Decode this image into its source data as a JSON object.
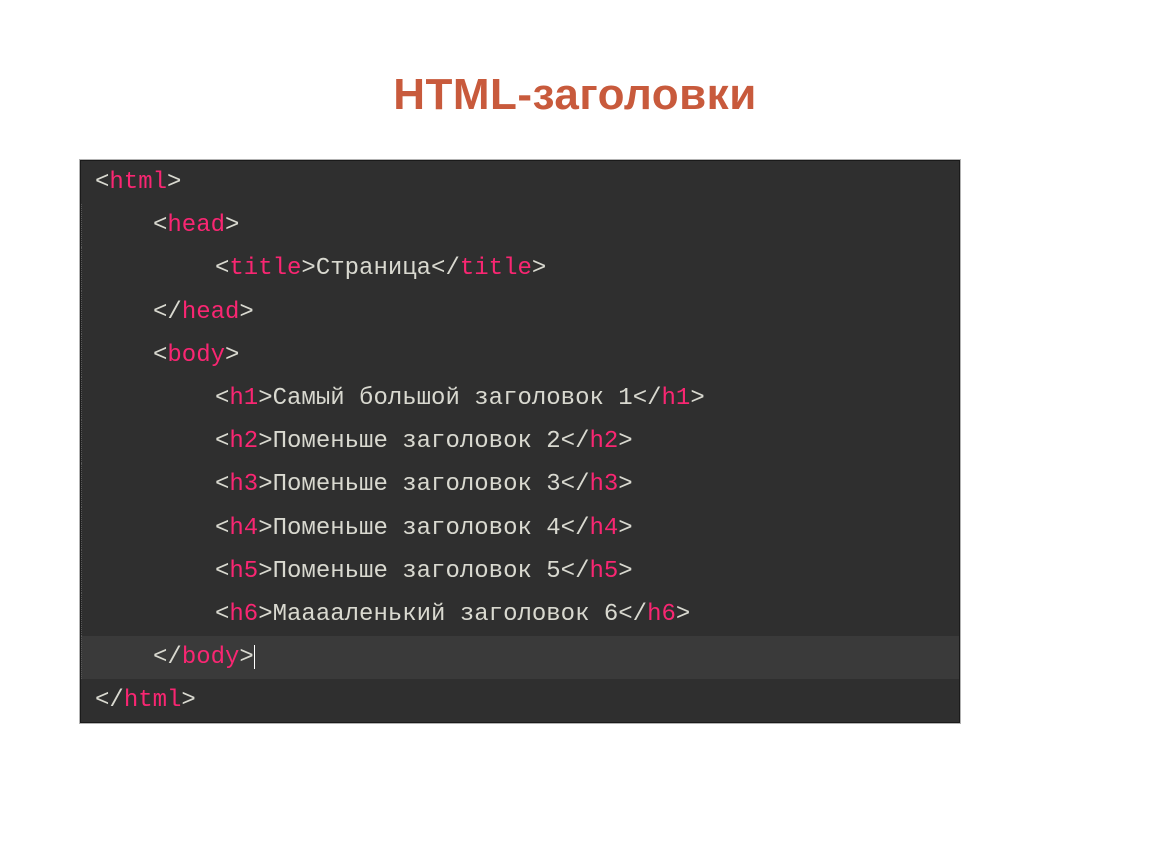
{
  "slide_title": "HTML-заголовки",
  "code": {
    "lines": [
      {
        "indent": 0,
        "highlight": false,
        "segments": [
          {
            "t": "br",
            "v": "<"
          },
          {
            "t": "tag",
            "v": "html"
          },
          {
            "t": "br",
            "v": ">"
          }
        ]
      },
      {
        "indent": 1,
        "highlight": false,
        "segments": [
          {
            "t": "br",
            "v": "<"
          },
          {
            "t": "tag",
            "v": "head"
          },
          {
            "t": "br",
            "v": ">"
          }
        ]
      },
      {
        "indent": 2,
        "highlight": false,
        "segments": [
          {
            "t": "br",
            "v": "<"
          },
          {
            "t": "tag",
            "v": "title"
          },
          {
            "t": "br",
            "v": ">"
          },
          {
            "t": "txt",
            "v": "Страница"
          },
          {
            "t": "br",
            "v": "</"
          },
          {
            "t": "tag",
            "v": "title"
          },
          {
            "t": "br",
            "v": ">"
          }
        ]
      },
      {
        "indent": 1,
        "highlight": false,
        "segments": [
          {
            "t": "br",
            "v": "</"
          },
          {
            "t": "tag",
            "v": "head"
          },
          {
            "t": "br",
            "v": ">"
          }
        ]
      },
      {
        "indent": 1,
        "highlight": false,
        "segments": [
          {
            "t": "br",
            "v": "<"
          },
          {
            "t": "tag",
            "v": "body"
          },
          {
            "t": "br",
            "v": ">"
          }
        ]
      },
      {
        "indent": 2,
        "highlight": false,
        "segments": [
          {
            "t": "br",
            "v": "<"
          },
          {
            "t": "tag",
            "v": "h1"
          },
          {
            "t": "br",
            "v": ">"
          },
          {
            "t": "txt",
            "v": "Самый большой заголовок 1"
          },
          {
            "t": "br",
            "v": "</"
          },
          {
            "t": "tag",
            "v": "h1"
          },
          {
            "t": "br",
            "v": ">"
          }
        ]
      },
      {
        "indent": 2,
        "highlight": false,
        "segments": [
          {
            "t": "br",
            "v": "<"
          },
          {
            "t": "tag",
            "v": "h2"
          },
          {
            "t": "br",
            "v": ">"
          },
          {
            "t": "txt",
            "v": "Поменьше заголовок 2"
          },
          {
            "t": "br",
            "v": "</"
          },
          {
            "t": "tag",
            "v": "h2"
          },
          {
            "t": "br",
            "v": ">"
          }
        ]
      },
      {
        "indent": 2,
        "highlight": false,
        "segments": [
          {
            "t": "br",
            "v": "<"
          },
          {
            "t": "tag",
            "v": "h3"
          },
          {
            "t": "br",
            "v": ">"
          },
          {
            "t": "txt",
            "v": "Поменьше заголовок 3"
          },
          {
            "t": "br",
            "v": "</"
          },
          {
            "t": "tag",
            "v": "h3"
          },
          {
            "t": "br",
            "v": ">"
          }
        ]
      },
      {
        "indent": 2,
        "highlight": false,
        "segments": [
          {
            "t": "br",
            "v": "<"
          },
          {
            "t": "tag",
            "v": "h4"
          },
          {
            "t": "br",
            "v": ">"
          },
          {
            "t": "txt",
            "v": "Поменьше заголовок 4"
          },
          {
            "t": "br",
            "v": "</"
          },
          {
            "t": "tag",
            "v": "h4"
          },
          {
            "t": "br",
            "v": ">"
          }
        ]
      },
      {
        "indent": 2,
        "highlight": false,
        "segments": [
          {
            "t": "br",
            "v": "<"
          },
          {
            "t": "tag",
            "v": "h5"
          },
          {
            "t": "br",
            "v": ">"
          },
          {
            "t": "txt",
            "v": "Поменьше заголовок 5"
          },
          {
            "t": "br",
            "v": "</"
          },
          {
            "t": "tag",
            "v": "h5"
          },
          {
            "t": "br",
            "v": ">"
          }
        ]
      },
      {
        "indent": 2,
        "highlight": false,
        "segments": [
          {
            "t": "br",
            "v": "<"
          },
          {
            "t": "tag",
            "v": "h6"
          },
          {
            "t": "br",
            "v": ">"
          },
          {
            "t": "txt",
            "v": "Мааааленький заголовок 6"
          },
          {
            "t": "br",
            "v": "</"
          },
          {
            "t": "tag",
            "v": "h6"
          },
          {
            "t": "br",
            "v": ">"
          }
        ]
      },
      {
        "indent": 1,
        "highlight": true,
        "caret": true,
        "segments": [
          {
            "t": "br",
            "v": "</"
          },
          {
            "t": "tag",
            "v": "body"
          },
          {
            "t": "br",
            "v": ">"
          }
        ]
      },
      {
        "indent": 0,
        "highlight": false,
        "segments": [
          {
            "t": "br",
            "v": "</"
          },
          {
            "t": "tag",
            "v": "html"
          },
          {
            "t": "br",
            "v": ">"
          }
        ]
      }
    ]
  }
}
